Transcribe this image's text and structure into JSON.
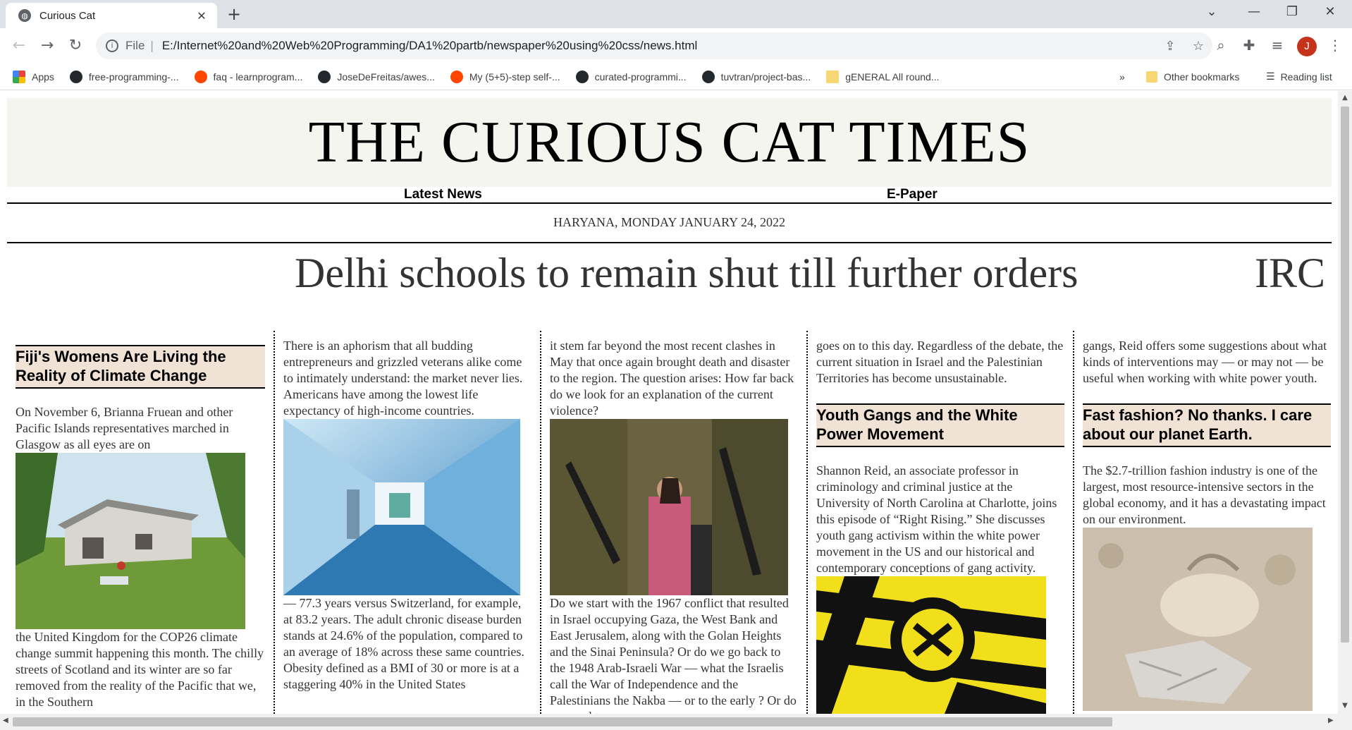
{
  "browser": {
    "tab_title": "Curious Cat",
    "url_scheme": "File",
    "url": "E:/Internet%20and%20Web%20Programming/DA1%20partb/newspaper%20using%20css/news.html",
    "avatar_letter": "J",
    "bookmarks": [
      {
        "label": "Apps",
        "icon": "apps-grid-icon"
      },
      {
        "label": "free-programming-...",
        "icon": "github-icon"
      },
      {
        "label": "faq - learnprogram...",
        "icon": "reddit-icon"
      },
      {
        "label": "JoseDeFreitas/awes...",
        "icon": "github-icon"
      },
      {
        "label": "My (5+5)-step self-...",
        "icon": "reddit-icon"
      },
      {
        "label": "curated-programmi...",
        "icon": "github-icon"
      },
      {
        "label": "tuvtran/project-bas...",
        "icon": "github-icon"
      },
      {
        "label": "gENERAL All round...",
        "icon": "folder-icon"
      }
    ],
    "overflow_label": "»",
    "other_bookmarks": "Other bookmarks",
    "reading_list": "Reading list"
  },
  "page": {
    "masthead": "THE CURIOUS CAT TIMES",
    "nav": [
      "Latest News",
      "E-Paper"
    ],
    "dateline": "HARYANA, MONDAY JANUARY 24, 2022",
    "ticker": [
      "Delhi schools to remain shut till further orders",
      "IRC"
    ],
    "columns": [
      {
        "headline": "Fiji's Womens Are Living the Reality of Climate Change",
        "text_before": "On November 6, Brianna Fruean and other Pacific Islands representatives marched in Glasgow as all eyes are on",
        "image": "fiji-house-photo",
        "text_after": "the United Kingdom for the COP26 climate change summit happening this month. The chilly streets of Scotland and its winter are so far removed from the reality of the Pacific that we, in the Southern"
      },
      {
        "text_before": "There is an aphorism that all budding entrepreneurs and grizzled veterans alike come to intimately understand: the market never lies. Americans have among the lowest life expectancy of high-income countries.",
        "image": "hospital-corridor-photo",
        "text_after": "— 77.3 years versus Switzerland, for example, at 83.2 years. The adult chronic disease burden stands at 24.6% of the population, compared to an average of 18% across these same countries. Obesity defined as a BMI of 30 or more is at a staggering 40% in the United States"
      },
      {
        "text_before": "it stem far beyond the most recent clashes in May that once again brought death and disaster to the region. The question arises: How far back do we look for an explanation of the current violence?",
        "image": "soldiers-photo",
        "text_after": "Do we start with the 1967 conflict that resulted in Israel occupying Gaza, the West Bank and East Jerusalem, along with the Golan Heights and the Sinai Peninsula? Or do we go back to the 1948 Arab-Israeli War — what the Israelis call the War of Independence and the Palestinians the Nakba — or to the early ? Or do we need to"
      },
      {
        "text_before": "goes on to this day. Regardless of the debate, the current situation in Israel and the Palestinian Territories has become unsustainable.",
        "headline": "Youth Gangs and the White Power Movement",
        "text_after": "Shannon Reid, an associate professor in criminology and criminal justice at the University of North Carolina at Charlotte, joins this episode of “Right Rising.” She discusses youth gang activism within the white power movement in the US and our historical and contemporary conceptions of gang activity.",
        "image": "gang-emblem-graphic"
      },
      {
        "text_before": "gangs, Reid offers some suggestions about what kinds of interventions may — or may not — be useful when working with white power youth.",
        "headline": "Fast fashion? No thanks. I care about our planet Earth.",
        "text_after": "The $2.7-trillion fashion industry is one of the largest, most resource-intensive sectors in the global economy, and it has a devastating impact on our environment.",
        "image": "discarded-clothes-photo"
      }
    ]
  }
}
